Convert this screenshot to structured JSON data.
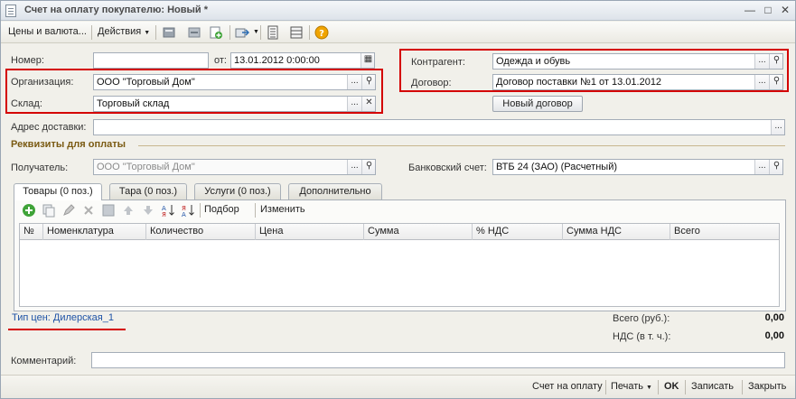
{
  "window": {
    "title": "Счет на оплату покупателю: Новый *",
    "controls": {
      "minimize": "—",
      "maximize": "□",
      "close": "✕"
    }
  },
  "toolbar": {
    "prices_currency": "Цены и валюта...",
    "actions": "Действия"
  },
  "header": {
    "number_label": "Номер:",
    "number_value": "",
    "date_label": "от:",
    "date_value": "13.01.2012  0:00:00",
    "org_label": "Организация:",
    "org_value": "ООО \"Торговый Дом\"",
    "warehouse_label": "Склад:",
    "warehouse_value": "Торговый склад",
    "counterparty_label": "Контрагент:",
    "counterparty_value": "Одежда и обувь",
    "contract_label": "Договор:",
    "contract_value": "Договор поставки №1 от 13.01.2012",
    "new_contract_button": "Новый договор",
    "delivery_label": "Адрес доставки:",
    "delivery_value": ""
  },
  "payment": {
    "section_title": "Реквизиты для оплаты",
    "recipient_label": "Получатель:",
    "recipient_value": "ООО \"Торговый Дом\"",
    "bank_label": "Банковский счет:",
    "bank_value": "ВТБ 24 (ЗАО) (Расчетный)"
  },
  "tabs": [
    {
      "label": "Товары (0 поз.)",
      "active": true
    },
    {
      "label": "Тара (0 поз.)",
      "active": false
    },
    {
      "label": "Услуги (0 поз.)",
      "active": false
    },
    {
      "label": "Дополнительно",
      "active": false
    }
  ],
  "table_toolbar": {
    "selection": "Подбор",
    "change": "Изменить"
  },
  "table": {
    "columns": [
      "№",
      "Номенклатура",
      "Количество",
      "Цена",
      "Сумма",
      "% НДС",
      "Сумма НДС",
      "Всего"
    ],
    "rows": []
  },
  "footer": {
    "price_type_link": "Тип цен: Дилерская_1",
    "total_label": "Всего (руб.):",
    "total_value": "0,00",
    "vat_label": "НДС (в т. ч.):",
    "vat_value": "0,00",
    "comment_label": "Комментарий:",
    "comment_value": ""
  },
  "bottom_bar": {
    "invoice": "Счет на оплату",
    "print": "Печать",
    "ok": "OK",
    "save": "Записать",
    "close": "Закрыть"
  },
  "colors": {
    "highlight_box": "#d40000",
    "link": "#1e52a6",
    "section_title": "#7a5a12"
  }
}
